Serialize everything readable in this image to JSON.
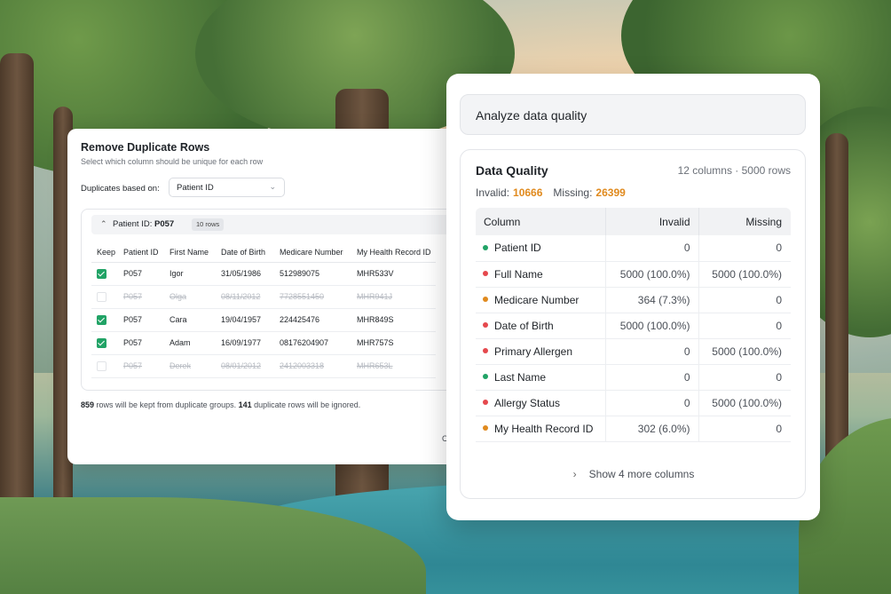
{
  "duplicates_panel": {
    "title": "Remove Duplicate Rows",
    "subtitle": "Select which column should be unique for each row",
    "based_on_label": "Duplicates based on:",
    "based_on_value": "Patient ID",
    "group": {
      "label_prefix": "Patient ID: ",
      "label_value": "P057",
      "count_badge": "10 rows"
    },
    "columns": [
      "Keep",
      "Patient ID",
      "First Name",
      "Date of Birth",
      "Medicare Number",
      "My Health Record ID"
    ],
    "rows": [
      {
        "keep": true,
        "cells": [
          "P057",
          "Igor",
          "31/05/1986",
          "512989075",
          "MHR533V"
        ]
      },
      {
        "keep": false,
        "cells": [
          "P057",
          "Olga",
          "08/11/2012",
          "7728551450",
          "MHR941J"
        ]
      },
      {
        "keep": true,
        "cells": [
          "P057",
          "Cara",
          "19/04/1957",
          "224425476",
          "MHR849S"
        ]
      },
      {
        "keep": true,
        "cells": [
          "P057",
          "Adam",
          "16/09/1977",
          "08176204907",
          "MHR757S"
        ]
      },
      {
        "keep": false,
        "cells": [
          "P057",
          "Derek",
          "08/01/2012",
          "2412003318",
          "MHR653L"
        ]
      }
    ],
    "footer": {
      "kept_count": "859",
      "kept_text": " rows will be kept from duplicate groups. ",
      "ignored_count": "141",
      "ignored_text": " duplicate rows will be ignored."
    },
    "cancel_label": "C"
  },
  "analyze_input": {
    "text": "Analyze data quality"
  },
  "data_quality": {
    "title": "Data Quality",
    "meta": "12 columns · 5000 rows",
    "invalid_label": "Invalid:",
    "invalid_value": "10666",
    "missing_label": "Missing:",
    "missing_value": "26399",
    "headers": [
      "Column",
      "Invalid",
      "Missing"
    ],
    "rows": [
      {
        "name": "Patient ID",
        "status_color": "#21a366",
        "invalid": "0",
        "missing": "0"
      },
      {
        "name": "Full Name",
        "status_color": "#e5484d",
        "invalid": "5000 (100.0%)",
        "missing": "5000 (100.0%)"
      },
      {
        "name": "Medicare Number",
        "status_color": "#e08a1e",
        "invalid": "364 (7.3%)",
        "missing": "0"
      },
      {
        "name": "Date of Birth",
        "status_color": "#e5484d",
        "invalid": "5000 (100.0%)",
        "missing": "0"
      },
      {
        "name": "Primary Allergen",
        "status_color": "#e5484d",
        "invalid": "0",
        "missing": "5000 (100.0%)"
      },
      {
        "name": "Last Name",
        "status_color": "#21a366",
        "invalid": "0",
        "missing": "0"
      },
      {
        "name": "Allergy Status",
        "status_color": "#e5484d",
        "invalid": "0",
        "missing": "5000 (100.0%)"
      },
      {
        "name": "My Health Record ID",
        "status_color": "#e08a1e",
        "invalid": "302 (6.0%)",
        "missing": "0"
      }
    ],
    "show_more": "Show 4 more columns"
  },
  "colors": {
    "accent_green": "#21a366",
    "warning_orange": "#e08a1e",
    "error_red": "#e5484d"
  }
}
